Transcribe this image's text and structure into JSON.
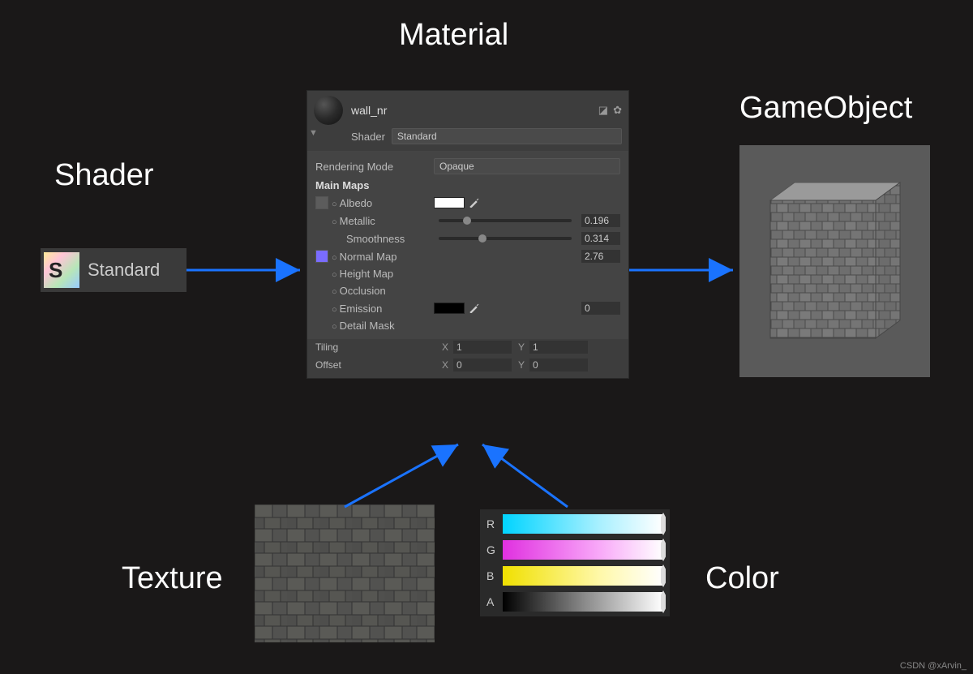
{
  "labels": {
    "material": "Material",
    "shader": "Shader",
    "gameobject": "GameObject",
    "texture": "Texture",
    "color": "Color"
  },
  "shaderNode": {
    "icon_letter": "S",
    "name": "Standard"
  },
  "materialPanel": {
    "name": "wall_nr",
    "shader_label": "Shader",
    "shader_value": "Standard",
    "rendering_mode_label": "Rendering Mode",
    "rendering_mode_value": "Opaque",
    "main_maps_label": "Main Maps",
    "albedo_label": "Albedo",
    "albedo_color": "#ffffff",
    "metallic_label": "Metallic",
    "metallic_value": "0.196",
    "smoothness_label": "Smoothness",
    "smoothness_value": "0.314",
    "normal_label": "Normal Map",
    "normal_value": "2.76",
    "height_label": "Height Map",
    "occlusion_label": "Occlusion",
    "emission_label": "Emission",
    "emission_color": "#000000",
    "emission_value": "0",
    "detail_mask_label": "Detail Mask",
    "tiling_label": "Tiling",
    "tiling_x": "1",
    "tiling_y": "1",
    "offset_label": "Offset",
    "offset_x": "0",
    "offset_y": "0",
    "x_label": "X",
    "y_label": "Y"
  },
  "colorNode": {
    "channels": [
      {
        "label": "R",
        "gradient": "linear-gradient(to right, #00d4ff 0%, #a8f0ff 60%, #ffffff 100%)"
      },
      {
        "label": "G",
        "gradient": "linear-gradient(to right, #e030e0 0%, #f8a8f8 60%, #ffffff 100%)"
      },
      {
        "label": "B",
        "gradient": "linear-gradient(to right, #f0e000 0%, #fff8a8 60%, #ffffff 100%)"
      },
      {
        "label": "A",
        "gradient": "linear-gradient(to right, #000000 0%, #888888 50%, #ffffff 100%)"
      }
    ]
  },
  "watermark": "CSDN @xArvin_"
}
